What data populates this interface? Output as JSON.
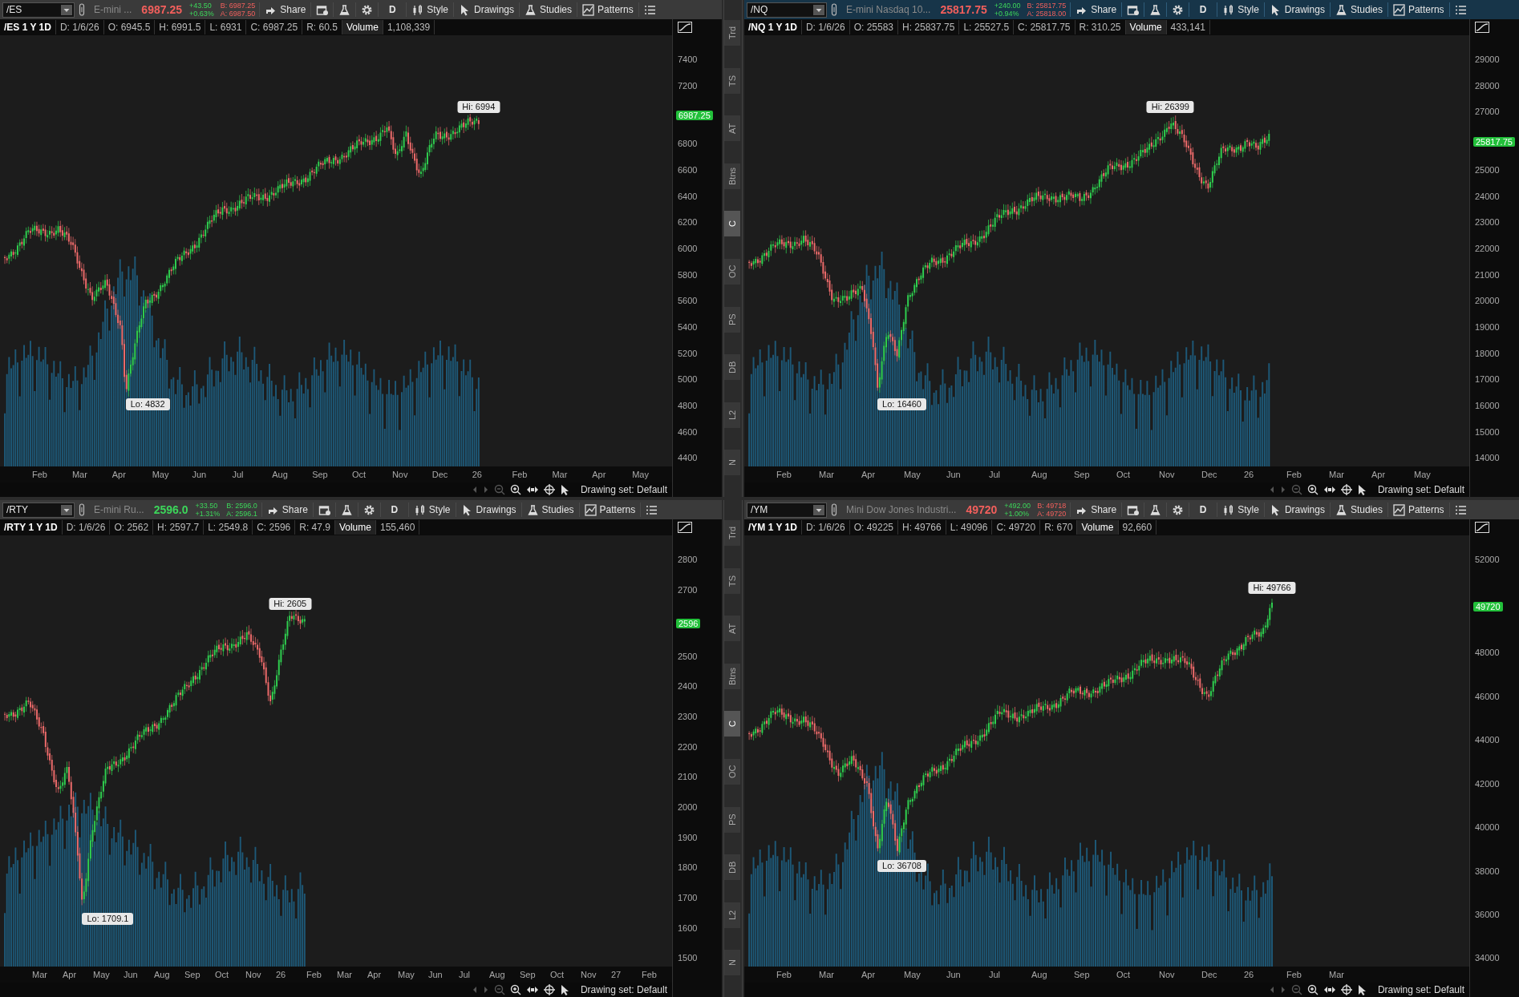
{
  "panels": [
    {
      "symbol": "/ES",
      "active": false,
      "description": "E-mini ...",
      "last": "6987.25",
      "last_rising": false,
      "change": "+43.50",
      "change_pct": "+0.63%",
      "change_rising": true,
      "bid": "B: 6987.25",
      "ask": "A: 6987.50",
      "bidask_rising": false,
      "toolbar": {
        "share": "Share",
        "aggregation": "D",
        "style": "Style",
        "drawings": "Drawings",
        "studies": "Studies",
        "patterns": "Patterns"
      },
      "info_title": "/ES 1 Y 1D",
      "info_fields": [
        "D: 1/6/26",
        "O: 6945.5",
        "H: 6991.5",
        "L: 6931",
        "C: 6987.25",
        "R: 60.5"
      ],
      "volume_label": "Volume",
      "volume": "1,108,339",
      "price_axis": [
        {
          "kind": "tick",
          "text": "7400"
        },
        {
          "kind": "tick",
          "text": "7200"
        },
        {
          "kind": "tag",
          "text": "6987.25"
        },
        {
          "kind": "tick",
          "text": "6800"
        },
        {
          "kind": "tick",
          "text": "6600"
        },
        {
          "kind": "tick",
          "text": "6400"
        },
        {
          "kind": "tick",
          "text": "6200"
        },
        {
          "kind": "tick",
          "text": "6000"
        },
        {
          "kind": "tick",
          "text": "5800"
        },
        {
          "kind": "tick",
          "text": "5600"
        },
        {
          "kind": "tick",
          "text": "5400"
        },
        {
          "kind": "tick",
          "text": "5200"
        },
        {
          "kind": "tick",
          "text": "5000"
        },
        {
          "kind": "tick",
          "text": "4800"
        },
        {
          "kind": "tick",
          "text": "4600"
        },
        {
          "kind": "tick",
          "text": "4400"
        }
      ],
      "hi": "Hi: 6994",
      "lo": "Lo: 4832",
      "months": [
        "Feb",
        "Mar",
        "Apr",
        "May",
        "Jun",
        "Jul",
        "Aug",
        "Sep",
        "Oct",
        "Nov",
        "Dec",
        "26",
        "Feb",
        "Mar",
        "Apr",
        "May"
      ],
      "drawing_set": "Drawing set: Default"
    },
    {
      "symbol": "/NQ",
      "active": true,
      "description": "E-mini Nasdaq 10...",
      "last": "25817.75",
      "last_rising": false,
      "change": "+240.00",
      "change_pct": "+0.94%",
      "change_rising": true,
      "bid": "B: 25817.75",
      "ask": "A: 25818.00",
      "bidask_rising": false,
      "toolbar": {
        "share": "Share",
        "aggregation": "D",
        "style": "Style",
        "drawings": "Drawings",
        "studies": "Studies",
        "patterns": "Patterns"
      },
      "info_title": "/NQ 1 Y 1D",
      "info_fields": [
        "D: 1/6/26",
        "O: 25583",
        "H: 25837.75",
        "L: 25527.5",
        "C: 25817.75",
        "R: 310.25"
      ],
      "volume_label": "Volume",
      "volume": "433,141",
      "price_axis": [
        {
          "kind": "tick",
          "text": "29000"
        },
        {
          "kind": "tick",
          "text": "28000"
        },
        {
          "kind": "tick",
          "text": "27000"
        },
        {
          "kind": "tag",
          "text": "25817.75"
        },
        {
          "kind": "tick",
          "text": "25000"
        },
        {
          "kind": "tick",
          "text": "24000"
        },
        {
          "kind": "tick",
          "text": "23000"
        },
        {
          "kind": "tick",
          "text": "22000"
        },
        {
          "kind": "tick",
          "text": "21000"
        },
        {
          "kind": "tick",
          "text": "20000"
        },
        {
          "kind": "tick",
          "text": "19000"
        },
        {
          "kind": "tick",
          "text": "18000"
        },
        {
          "kind": "tick",
          "text": "17000"
        },
        {
          "kind": "tick",
          "text": "16000"
        },
        {
          "kind": "tick",
          "text": "15000"
        },
        {
          "kind": "tick",
          "text": "14000"
        }
      ],
      "hi": "Hi: 26399",
      "lo": "Lo: 16460",
      "months": [
        "Feb",
        "Mar",
        "Apr",
        "May",
        "Jun",
        "Jul",
        "Aug",
        "Sep",
        "Oct",
        "Nov",
        "Dec",
        "26",
        "Feb",
        "Mar",
        "Apr",
        "May"
      ],
      "drawing_set": "Drawing set: Default"
    },
    {
      "symbol": "/RTY",
      "active": false,
      "description": "E-mini Ru...",
      "last": "2596.0",
      "last_rising": true,
      "change": "+33.50",
      "change_pct": "+1.31%",
      "change_rising": true,
      "bid": "B: 2596.0",
      "ask": "A: 2596.1",
      "bidask_rising": true,
      "toolbar": {
        "share": "Share",
        "aggregation": "D",
        "style": "Style",
        "drawings": "Drawings",
        "studies": "Studies",
        "patterns": "Patterns"
      },
      "info_title": "/RTY 1 Y 1D",
      "info_fields": [
        "D: 1/6/26",
        "O: 2562",
        "H: 2597.7",
        "L: 2549.8",
        "C: 2596",
        "R: 47.9"
      ],
      "volume_label": "Volume",
      "volume": "155,460",
      "price_axis": [
        {
          "kind": "tick",
          "text": "2800"
        },
        {
          "kind": "tick",
          "text": "2700"
        },
        {
          "kind": "tag",
          "text": "2596"
        },
        {
          "kind": "tick",
          "text": "2500"
        },
        {
          "kind": "tick",
          "text": "2400"
        },
        {
          "kind": "tick",
          "text": "2300"
        },
        {
          "kind": "tick",
          "text": "2200"
        },
        {
          "kind": "tick",
          "text": "2100"
        },
        {
          "kind": "tick",
          "text": "2000"
        },
        {
          "kind": "tick",
          "text": "1900"
        },
        {
          "kind": "tick",
          "text": "1800"
        },
        {
          "kind": "tick",
          "text": "1700"
        },
        {
          "kind": "tick",
          "text": "1600"
        },
        {
          "kind": "tick",
          "text": "1500"
        }
      ],
      "hi": "Hi: 2605",
      "lo": "Lo: 1709.1",
      "months": [
        "Mar",
        "Apr",
        "May",
        "Jun",
        "Aug",
        "Sep",
        "Oct",
        "Nov",
        "26",
        "Feb",
        "Mar",
        "Apr",
        "May",
        "Jun",
        "Jul",
        "Aug",
        "Sep",
        "Oct",
        "Nov",
        "27",
        "Feb"
      ],
      "drawing_set": "Drawing set: Default"
    },
    {
      "symbol": "/YM",
      "active": false,
      "description": "Mini Dow Jones Industri...",
      "last": "49720",
      "last_rising": false,
      "change": "+492.00",
      "change_pct": "+1.00%",
      "change_rising": true,
      "bid": "B: 49718",
      "ask": "A: 49720",
      "bidask_rising": false,
      "toolbar": {
        "share": "Share",
        "aggregation": "D",
        "style": "Style",
        "drawings": "Drawings",
        "studies": "Studies",
        "patterns": "Patterns"
      },
      "info_title": "/YM 1 Y 1D",
      "info_fields": [
        "D: 1/6/26",
        "O: 49225",
        "H: 49766",
        "L: 49096",
        "C: 49720",
        "R: 670"
      ],
      "volume_label": "Volume",
      "volume": "92,660",
      "price_axis": [
        {
          "kind": "tick",
          "text": "52000"
        },
        {
          "kind": "tag",
          "text": "49720"
        },
        {
          "kind": "tick",
          "text": "48000"
        },
        {
          "kind": "tick",
          "text": "46000"
        },
        {
          "kind": "tick",
          "text": "44000"
        },
        {
          "kind": "tick",
          "text": "42000"
        },
        {
          "kind": "tick",
          "text": "40000"
        },
        {
          "kind": "tick",
          "text": "38000"
        },
        {
          "kind": "tick",
          "text": "36000"
        },
        {
          "kind": "tick",
          "text": "34000"
        }
      ],
      "hi": "Hi: 49766",
      "lo": "Lo: 36708",
      "months": [
        "Feb",
        "Mar",
        "Apr",
        "May",
        "Jun",
        "Jul",
        "Aug",
        "Sep",
        "Oct",
        "Nov",
        "Dec",
        "26",
        "Feb",
        "Mar"
      ],
      "drawing_set": "Drawing set: Default"
    }
  ],
  "side_strips": [
    {
      "tabs": [
        {
          "label": "Trd",
          "selected": false
        },
        {
          "label": "TS",
          "selected": false
        },
        {
          "label": "AT",
          "selected": false
        },
        {
          "label": "Btns",
          "selected": false
        },
        {
          "label": "C",
          "selected": true
        },
        {
          "label": "OC",
          "selected": false
        },
        {
          "label": "PS",
          "selected": false
        },
        {
          "label": "DB",
          "selected": false
        },
        {
          "label": "L2",
          "selected": false
        },
        {
          "label": "N",
          "selected": false
        }
      ]
    },
    {
      "tabs": [
        {
          "label": "Trd",
          "selected": false
        },
        {
          "label": "TS",
          "selected": false
        },
        {
          "label": "AT",
          "selected": false
        },
        {
          "label": "Btns",
          "selected": false
        },
        {
          "label": "C",
          "selected": true
        },
        {
          "label": "OC",
          "selected": false
        },
        {
          "label": "PS",
          "selected": false
        },
        {
          "label": "DB",
          "selected": false
        },
        {
          "label": "L2",
          "selected": false
        },
        {
          "label": "N",
          "selected": false
        }
      ]
    }
  ]
}
